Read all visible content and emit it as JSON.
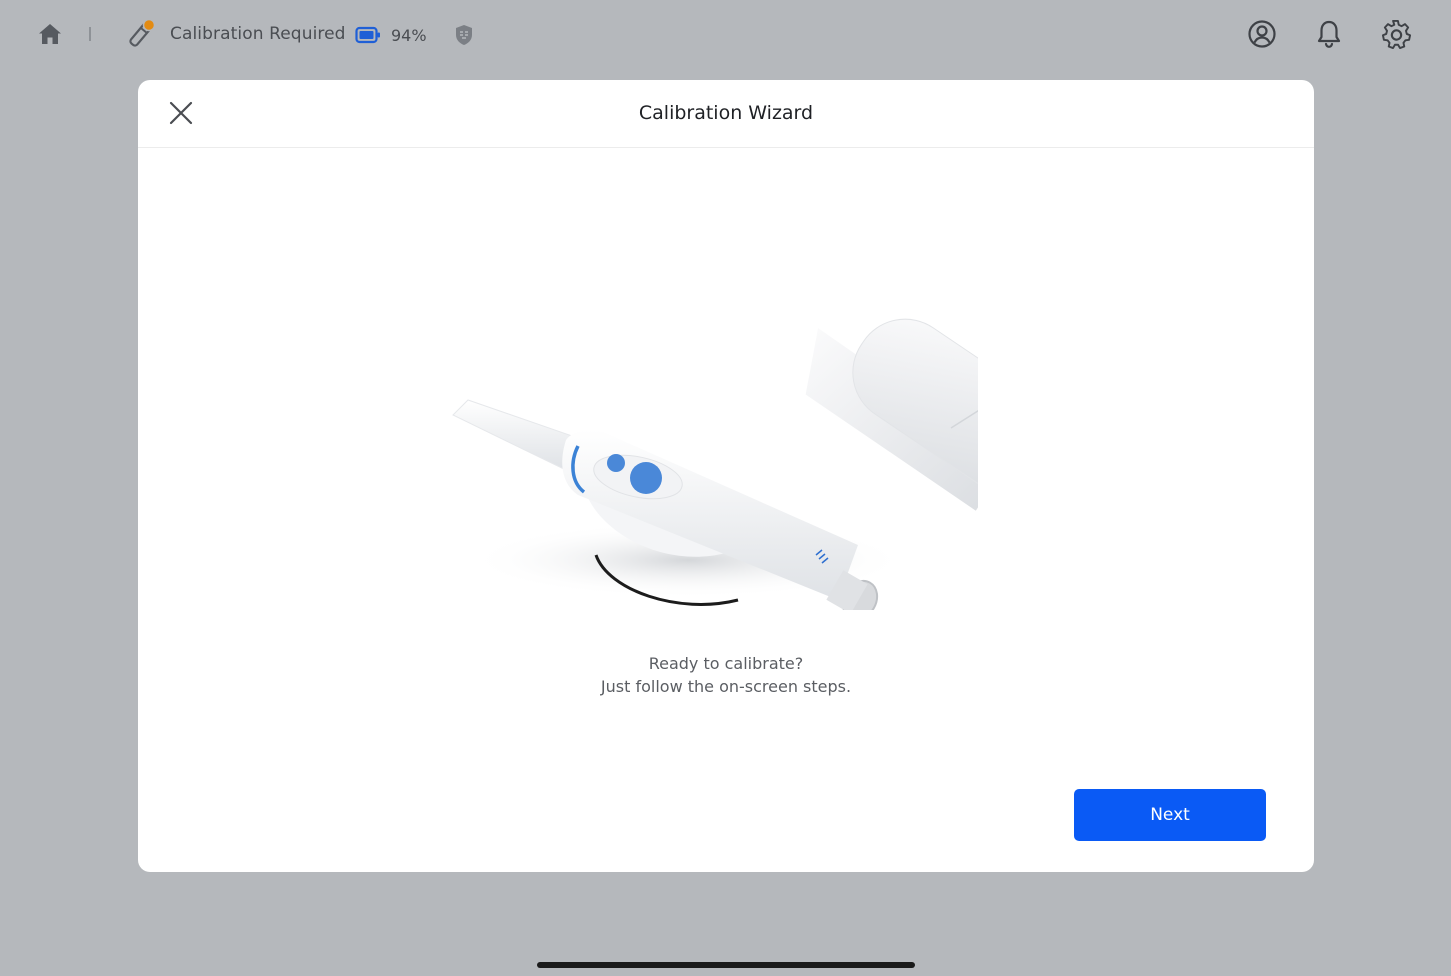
{
  "status_bar": {
    "scanner_status_label": "Calibration Required",
    "battery_percent": "94%",
    "icons": {
      "home": "home-icon",
      "scanner": "scanner-warning-icon",
      "battery": "battery-icon",
      "shield": "shield-icon",
      "profile": "user-profile-icon",
      "notifications": "bell-icon",
      "settings": "gear-icon"
    },
    "warning_dot_color": "#e38b12",
    "battery_color": "#1f5fd6"
  },
  "modal": {
    "title": "Calibration Wizard",
    "message_line1": "Ready to calibrate?",
    "message_line2": "Just follow the on-screen steps.",
    "next_label": "Next",
    "close_icon": "close-icon",
    "accent_color": "#0a5af5"
  }
}
